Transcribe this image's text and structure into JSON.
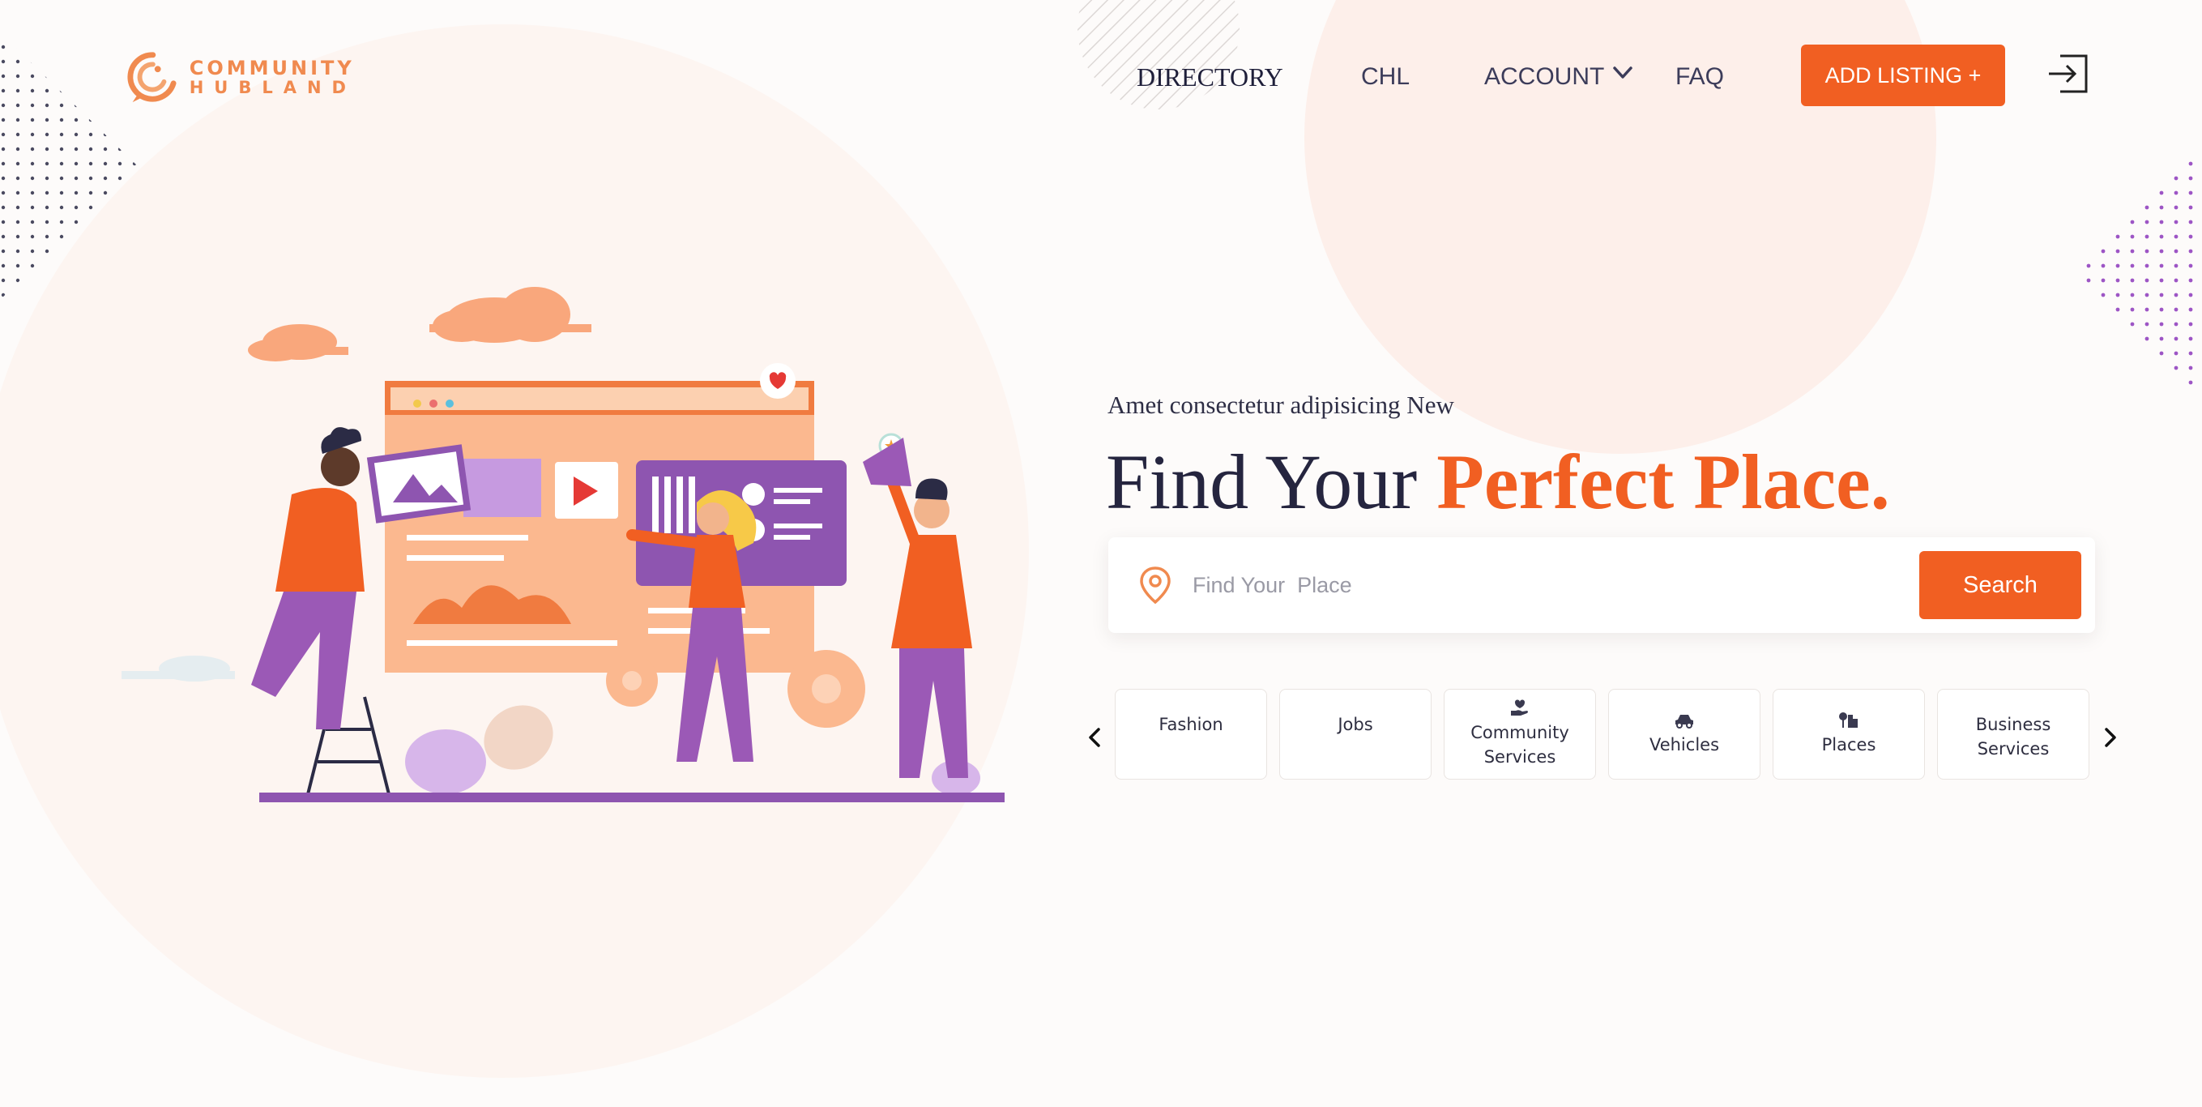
{
  "brand": {
    "line1": "COMMUNITY",
    "line2": "HUBLAND"
  },
  "nav": {
    "directory": "DIRECTORY",
    "chl": "CHL",
    "account": "ACCOUNT",
    "faq": "FAQ",
    "add_listing": "ADD LISTING +"
  },
  "hero": {
    "eyebrow": "Amet consectetur adipisicing New",
    "headline_plain": "Find Your ",
    "headline_accent": "Perfect Place."
  },
  "search": {
    "placeholder": "Find Your  Place",
    "value": "",
    "button_label": "Search"
  },
  "categories": [
    {
      "label": "Fashion",
      "icon": "none"
    },
    {
      "label": "Jobs",
      "icon": "none"
    },
    {
      "label": "Community Services",
      "icon": "hand-heart-icon"
    },
    {
      "label": "Vehicles",
      "icon": "vehicle-icon"
    },
    {
      "label": "Places",
      "icon": "places-icon"
    },
    {
      "label": "Business Services",
      "icon": "none"
    }
  ],
  "colors": {
    "accent": "#f15f22",
    "text_dark": "#25253f",
    "background": "#fdfbfa",
    "blob": "#fdf1ec",
    "purple": "#9b59b6"
  }
}
